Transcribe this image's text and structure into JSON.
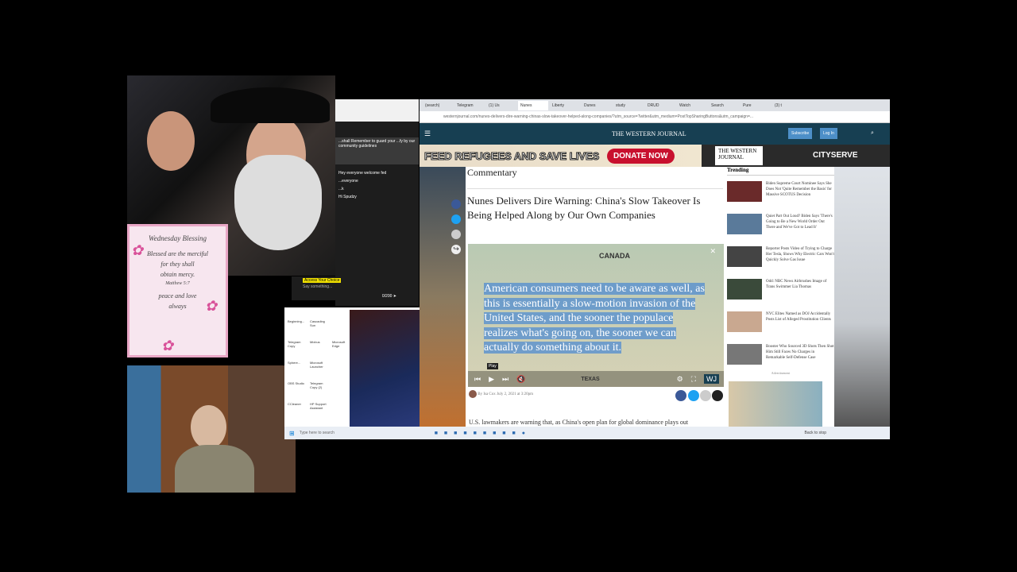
{
  "card": {
    "title": "Wednesday Blessing",
    "lines": [
      "Blessed are the merciful",
      "for they shall",
      "obtain mercy.",
      "Matthew 5:7",
      "peace and love",
      "always"
    ]
  },
  "chat": {
    "pinned": "...shall Remember to guard your ...fy by our community guidelines",
    "messages": [
      "Hey everyone welcome fed",
      "...everyone",
      "...k",
      "Hi Spudzy"
    ],
    "badge": "Access Your Choice",
    "input_placeholder": "Say something...",
    "counter": "0/200"
  },
  "desktop": {
    "icons": [
      "Beginning...",
      "Cascading Sun",
      "Telegram Copy",
      "Mixbus",
      "Microsoft Edge",
      "Sphere...",
      "Microsoft Launcher",
      "OBS Studio",
      "Telegram Copy (2)",
      "CCleaner",
      "HP Support Assistant"
    ],
    "search_placeholder": "Type here to search"
  },
  "browser": {
    "tabs": [
      "(search)",
      "Telegram",
      "(1) Us",
      "Nunes",
      "Liberty",
      "Dunes",
      "study",
      "DRUD",
      "Watch",
      "Search",
      "Pure",
      "(3) t"
    ],
    "url": "westernjournal.com/nunes-delivers-dire-warning-chinas-slow-takeover-helped-along-companies/?utm_source=Twitter&utm_medium=PostTopSharingButtons&utm_campaign=...",
    "site_logo": "THE WESTERN JOURNAL",
    "subscribe": "Subscribe",
    "login": "Log In",
    "banner": {
      "headline": "FEED REFUGEES AND SAVE LIVES",
      "donate": "DONATE NOW",
      "logo": "THE WESTERN JOURNAL",
      "partner": "CITYSERVE"
    },
    "article": {
      "category": "Commentary",
      "title": "Nunes Delivers Dire Warning: China's Slow Takeover Is Being Helped Along by Our Own Companies",
      "video": {
        "map_label_top": "CANADA",
        "map_label_bottom": "TEXAS",
        "caption": "American consumers need to be aware as well, as this is essentially a slow-motion invasion of the United States, and the sooner the populace realizes what's going on, the sooner we can actually do something about it.",
        "tooltip": "Play"
      },
      "byline": "By Isa Cox  July 2, 2021 at 3:20pm",
      "body": "U.S. lawmakers are warning that, as China's open plan for global dominance plays out"
    },
    "trending": {
      "heading": "Trending",
      "items": [
        "Biden Supreme Court Nominee Says She Does Not 'Quite Remember the Basis' for Massive SCOTUS Decision",
        "Quiet Part Out Loud? Biden Says 'There's Going to Be a New World Order Out There and We've Got to Lead It'",
        "Reporter Posts Video of Trying to Charge Her Tesla, Shows Why Electric Cars Won't Quickly Solve Gas Issue",
        "Odd: NBC News Airbrushes Image of Trans Swimmer Lia Thomas",
        "NYC Elites Named as DOJ Accidentally Posts List of Alleged Prostitution Clients",
        "Booster Who Sourced 3D Shots Then Shot Him Still Faces No Charges in Remarkable Self-Defense Case"
      ],
      "ad_label": "Advertisement"
    }
  },
  "taskbar": {
    "search": "Type here to search",
    "status": "Back to stop"
  }
}
